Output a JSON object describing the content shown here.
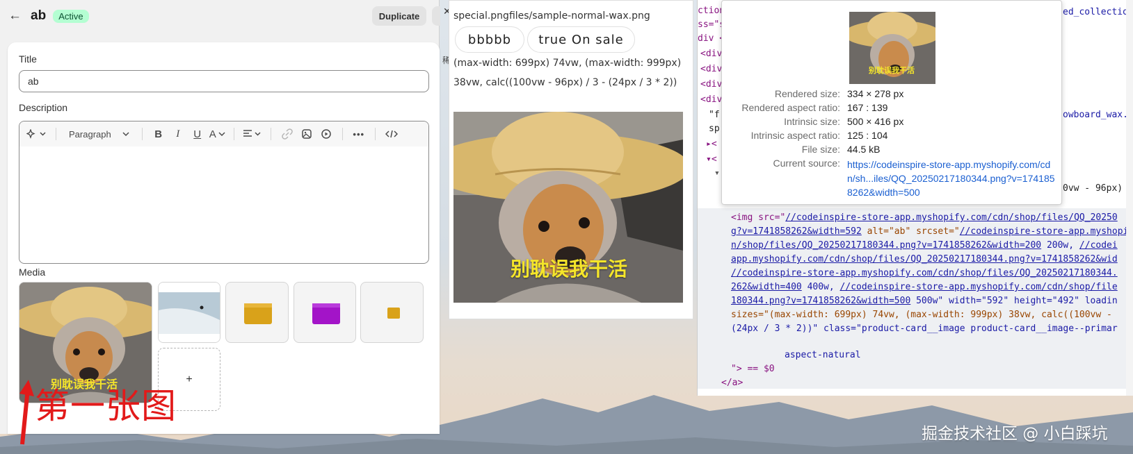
{
  "admin": {
    "product_title": "ab",
    "status": "Active",
    "duplicate_label": "Duplicate",
    "title_label": "Title",
    "title_value": "ab",
    "description_label": "Description",
    "paragraph_label": "Paragraph",
    "media_label": "Media",
    "add_media_label": "+",
    "annotation": "第一张图",
    "annotation_color": "#e21a1a"
  },
  "store": {
    "top_text": "special.pngfiles/sample-normal-wax.png",
    "pill_1": "bbbbb",
    "pill_2": "true On sale",
    "sizes_text": "(max-width: 699px) 74vw, (max-width: 999px) 38vw, calc((100vw - 96px) / 3 - (24px / 3 * 2))",
    "image_caption": "别耽误我干活",
    "gutter_char": "稀"
  },
  "devtools": {
    "top_lines": [
      "ction",
      "ss=\"s",
      "div <",
      "<div",
      "<div",
      "<div",
      "<div"
    ],
    "partial_right_1": "ed_collectio",
    "partial_right_2": "owboard_wax.",
    "partial_right_3": "0vw - 96px)",
    "left_frag_1": "\"f",
    "left_frag_2": "sp",
    "img_tag": "<img src=\"",
    "src_url": "//codeinspire-store-app.myshopify.com/cdn/shop/files/QQ_20250",
    "src_cont": "g?v=1741858262&width=592",
    "alt_attr": " alt=\"ab\" srcset=\"",
    "srcset_1": "//codeinspire-store-app.myshopify.com",
    "srcset_2": "n/shop/files/QQ_20250217180344.png?v=1741858262&width=200",
    "srcset_2b": " 200w, ",
    "srcset_2c": "//codei",
    "srcset_3": "app.myshopify.com/cdn/shop/files/QQ_20250217180344.png?v=1741858262&wid",
    "srcset_4": "//codeinspire-store-app.myshopify.com/cdn/shop/files/QQ_20250217180344.",
    "srcset_5": "262&width=400",
    "srcset_5b": " 400w, ",
    "srcset_5c": "//codeinspire-store-app.myshopify.com/cdn/shop/file",
    "srcset_6": "180344.png?v=1741858262&width=500",
    "srcset_6b": " 500w\" width=\"592\" height=\"492\" loadin",
    "sizes_line": "sizes=\"(max-width: 699px) 74vw, (max-width: 999px) 38vw, calc((100vw -",
    "sizes_line2": "(24px / 3 * 2))\" class=\"product-card__image product-card__image--primar",
    "aspect_line": "aspect-natural",
    "end_line": "\"> == $0",
    "close_a": "</a>"
  },
  "tooltip": {
    "rows": [
      {
        "key": "Rendered size:",
        "val": "334 × 278 px"
      },
      {
        "key": "Rendered aspect ratio:",
        "val": "167 : 139"
      },
      {
        "key": "Intrinsic size:",
        "val": "500 × 416 px"
      },
      {
        "key": "Intrinsic aspect ratio:",
        "val": "125 : 104"
      },
      {
        "key": "File size:",
        "val": "44.5 kB"
      }
    ],
    "source_key": "Current source:",
    "source_val": "https://codeinspire-store-app.myshopify.com/cdn/sh...iles/QQ_20250217180344.png?v=1741858262&width=500",
    "thumb_caption": "别耽误我干活"
  },
  "watermark": "掘金技术社区 @ 小白踩坑",
  "colors": {
    "accent_link": "#1a5fd1",
    "badge_bg": "#b4fed2",
    "caption_yellow": "#f5e52a"
  }
}
